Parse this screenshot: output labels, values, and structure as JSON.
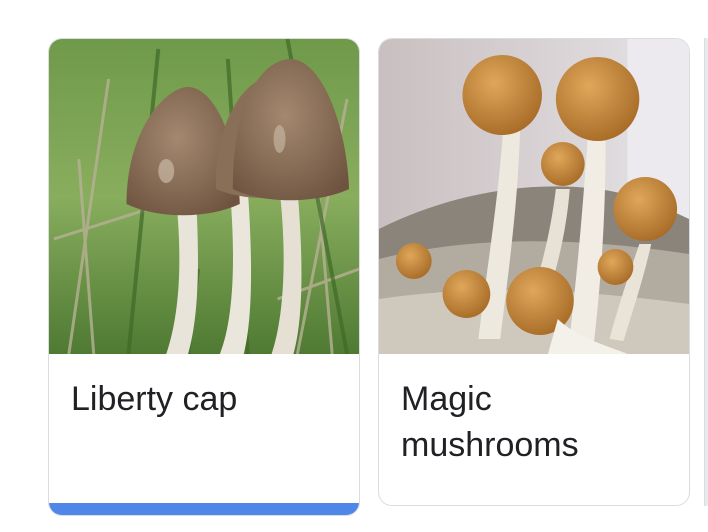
{
  "cards": [
    {
      "label": "Liberty cap",
      "image": "liberty-cap-mushroom-photo",
      "selected": true
    },
    {
      "label": "Magic mushrooms",
      "image": "magic-mushrooms-photo",
      "selected": false
    }
  ],
  "colors": {
    "selected_indicator": "#4f87e8",
    "card_border": "#dadce0",
    "text": "#202124"
  }
}
